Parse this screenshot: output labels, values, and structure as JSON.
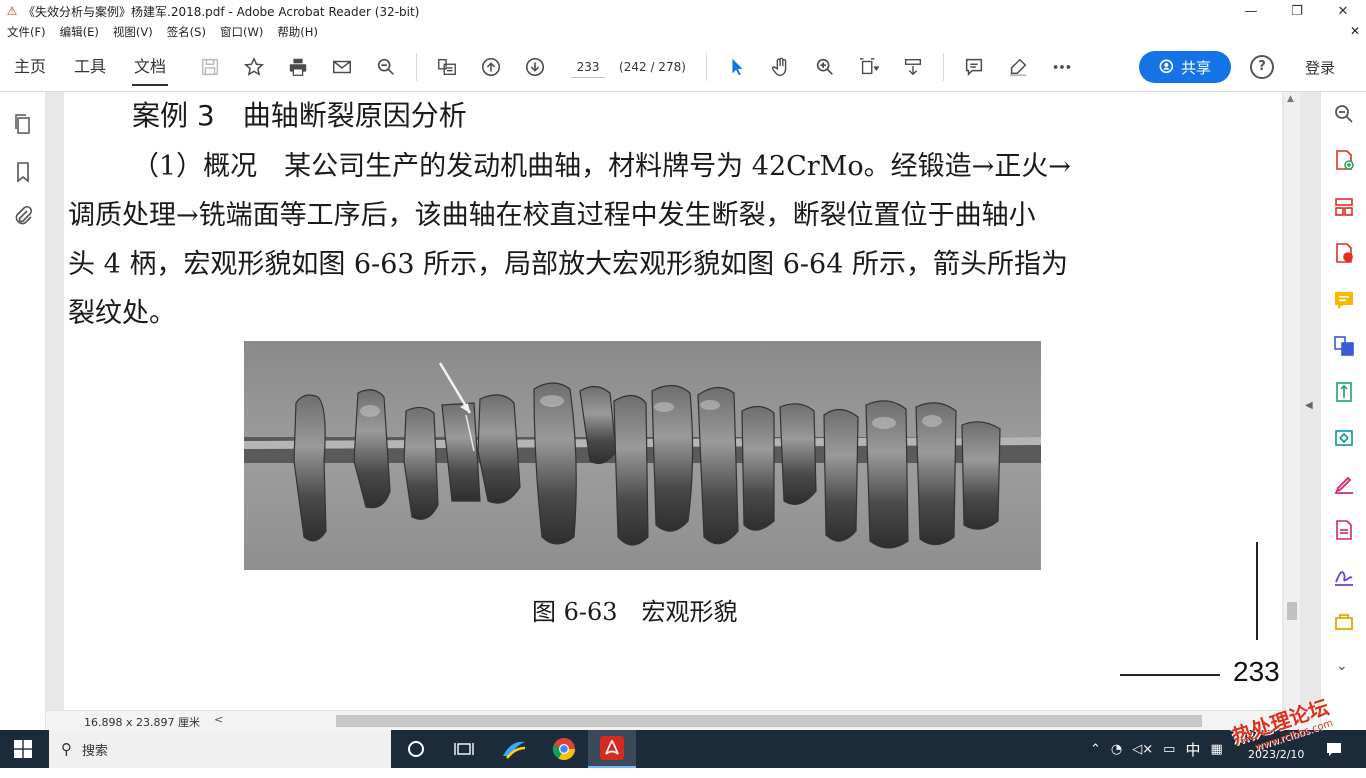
{
  "window": {
    "title": "《失效分析与案例》杨建军.2018.pdf - Adobe Acrobat Reader (32-bit)",
    "minimize": "—",
    "maximize": "❐",
    "close": "✕"
  },
  "menu": {
    "items": [
      "文件(F)",
      "编辑(E)",
      "视图(V)",
      "签名(S)",
      "窗口(W)",
      "帮助(H)"
    ],
    "close": "✕"
  },
  "toolbar": {
    "tabs": [
      "主页",
      "工具",
      "文档"
    ],
    "active_tab": "文档",
    "page_input": "233",
    "page_count": "(242 / 278)",
    "share_label": "共享",
    "help_label": "?",
    "login_label": "登录"
  },
  "document": {
    "heading": "案例 3　曲轴断裂原因分析",
    "paragraph_lines": [
      "（1）概况　某公司生产的发动机曲轴，材料牌号为 42CrMo。经锻造→正火→",
      "调质处理→铣端面等工序后，该曲轴在校直过程中发生断裂，断裂位置位于曲轴小",
      "头 4 柄，宏观形貌如图 6-63 所示，局部放大宏观形貌如图 6-64 所示，箭头所指为",
      "裂纹处。"
    ],
    "figure_caption": "图 6-63　宏观形貌",
    "page_number": "233"
  },
  "statusbar": {
    "page_size": "16.898 x 23.897 厘米",
    "scroll_left": "<"
  },
  "taskbar": {
    "search_placeholder": "搜索",
    "ime": "中",
    "date": "2023/2/10"
  },
  "watermark": {
    "main": "热处理论坛",
    "sub": "www.rclbbs.com"
  },
  "colors": {
    "accent": "#1473e6",
    "taskbar": "#1c2b3a",
    "acrobat_red": "#d52b1e"
  }
}
